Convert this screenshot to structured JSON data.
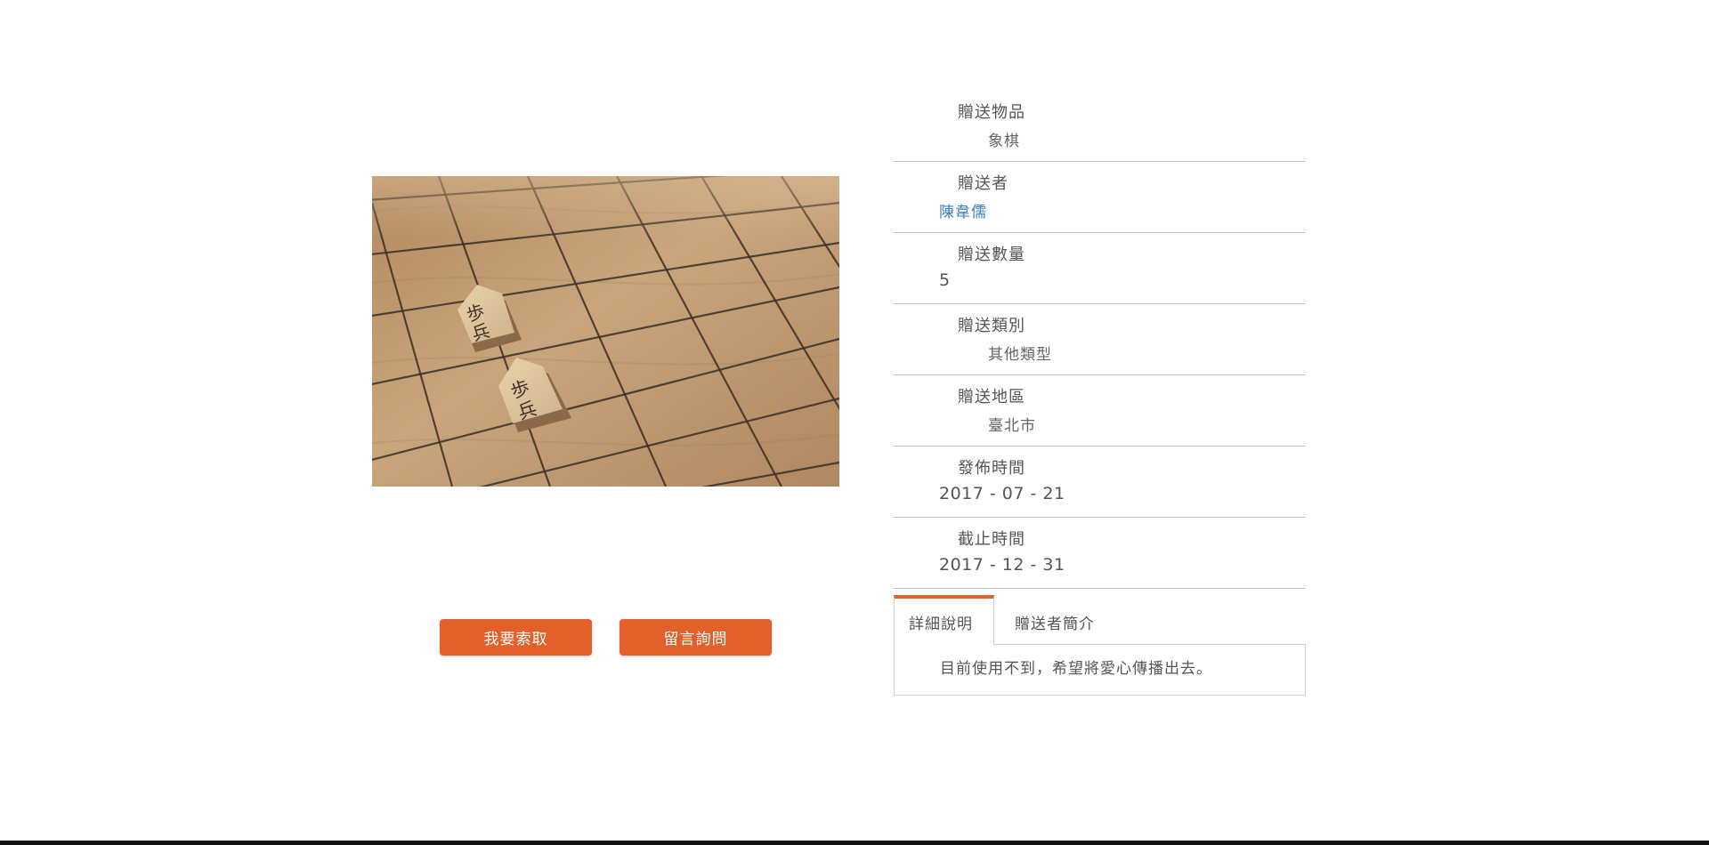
{
  "item": {
    "photo_alt": "shogi-pieces-on-board",
    "piece_text": "歩兵"
  },
  "actions": {
    "claim_label": "我要索取",
    "ask_label": "留言詢問"
  },
  "fields": [
    {
      "label": "贈送物品",
      "value": "象棋"
    },
    {
      "label": "贈送者",
      "value": "陳韋儒"
    },
    {
      "label": "贈送數量",
      "value": "5"
    },
    {
      "label": "贈送類別",
      "value": "其他類型"
    },
    {
      "label": "贈送地區",
      "value": "臺北市"
    },
    {
      "label": "發佈時間",
      "value": "2017 - 07 - 21"
    },
    {
      "label": "截止時間",
      "value": "2017 - 12 - 31"
    }
  ],
  "tabs": [
    {
      "label": "詳細說明",
      "active": true
    },
    {
      "label": "贈送者簡介",
      "active": false
    }
  ],
  "tab_content": {
    "description": "目前使用不到，希望將愛心傳播出去。"
  },
  "colors": {
    "accent": "#e4602a",
    "link": "#3d7dbd",
    "divider": "#c4c4c4"
  }
}
